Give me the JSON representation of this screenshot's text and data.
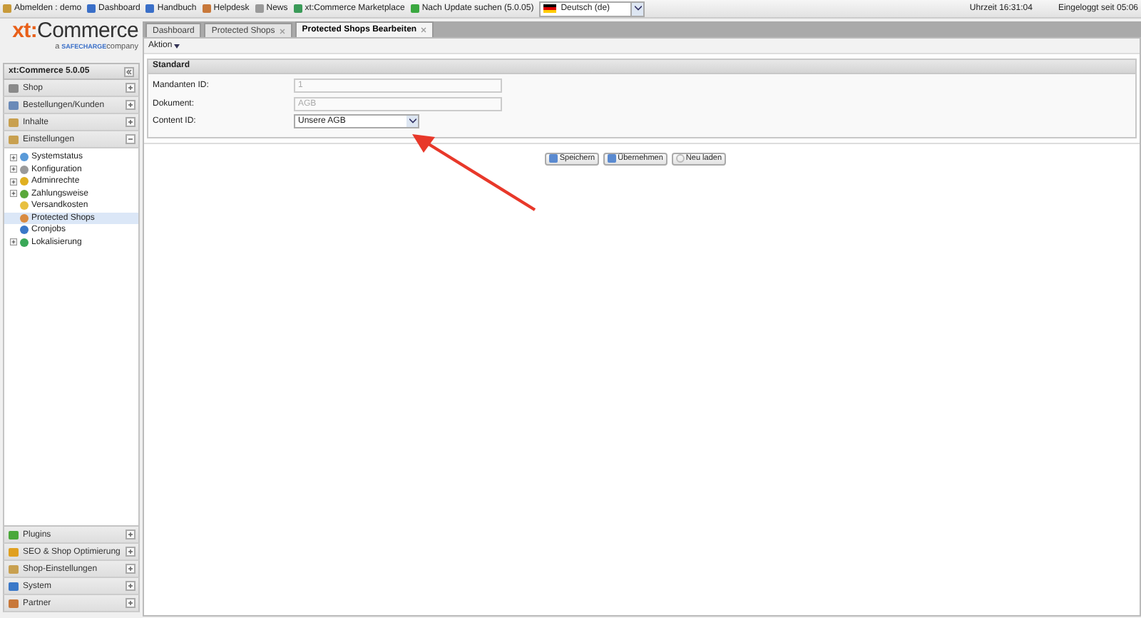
{
  "top_bar": {
    "items": [
      {
        "label": "Abmelden : demo",
        "kind": "logout"
      },
      {
        "label": "Dashboard",
        "kind": "chart"
      },
      {
        "label": "Handbuch",
        "kind": "book"
      },
      {
        "label": "Helpdesk",
        "kind": "person"
      },
      {
        "label": "News",
        "kind": "link"
      },
      {
        "label": "xt:Commerce Marketplace",
        "kind": "globe"
      },
      {
        "label": "Nach Update suchen (5.0.05)",
        "kind": "refresh"
      }
    ],
    "language": {
      "value": "Deutsch (de)"
    },
    "clock": "Uhrzeit 16:31:04",
    "session": "Eingeloggt seit 05:06"
  },
  "logo": {
    "brand_a": "xt:",
    "brand_b": "Commerce",
    "tagline_a": "a",
    "tagline_b": "SAFECHARGE",
    "tagline_c": "company"
  },
  "sidebar": {
    "title": "xt:Commerce 5.0.05",
    "panels": [
      {
        "label": "Shop",
        "expanded": false,
        "kind": "cart"
      },
      {
        "label": "Bestellungen/Kunden",
        "kind": "truck",
        "expanded": false
      },
      {
        "label": "Inhalte",
        "kind": "folder",
        "expanded": false
      },
      {
        "label": "Einstellungen",
        "kind": "folder",
        "expanded": true,
        "items": [
          {
            "label": "Systemstatus",
            "expanded": false,
            "selected": false,
            "color": "#5a9ad8"
          },
          {
            "label": "Konfiguration",
            "expanded": false,
            "selected": false,
            "color": "#9a9a9a"
          },
          {
            "label": "Adminrechte",
            "expanded": false,
            "selected": false,
            "color": "#e0b020"
          },
          {
            "label": "Zahlungsweise",
            "expanded": false,
            "selected": false,
            "color": "#5aa83a"
          },
          {
            "label": "Versandkosten",
            "selected": false,
            "color": "#e8c040"
          },
          {
            "label": "Protected Shops",
            "selected": true,
            "color": "#d88a40"
          },
          {
            "label": "Cronjobs",
            "selected": false,
            "color": "#3a78c8"
          },
          {
            "label": "Lokalisierung",
            "expanded": false,
            "selected": false,
            "color": "#3aa858"
          }
        ]
      }
    ],
    "bottom_panels": [
      {
        "label": "Plugins",
        "kind": "puzzle",
        "expanded": false
      },
      {
        "label": "SEO & Shop Optimierung",
        "kind": "bolt",
        "expanded": false
      },
      {
        "label": "Shop-Einstellungen",
        "kind": "folder",
        "expanded": false
      },
      {
        "label": "System",
        "kind": "monitor",
        "expanded": false
      },
      {
        "label": "Partner",
        "kind": "person",
        "expanded": false
      }
    ]
  },
  "tabs": [
    {
      "label": "Dashboard",
      "selected": false,
      "closable": false
    },
    {
      "label": "Protected Shops",
      "selected": false,
      "closable": true
    },
    {
      "label": "Protected Shops Bearbeiten",
      "selected": true,
      "closable": true
    }
  ],
  "toolbar": {
    "menu": "Aktion"
  },
  "form": {
    "title": "Standard",
    "fields": [
      {
        "label": "Mandanten ID:",
        "value": "1",
        "kind": "text",
        "disabled": true
      },
      {
        "label": "Dokument:",
        "value": "AGB",
        "kind": "text",
        "disabled": true
      },
      {
        "label": "Content ID:",
        "value": "Unsere AGB",
        "kind": "select",
        "disabled": false
      }
    ]
  },
  "buttons": [
    {
      "label": "Speichern",
      "kind": "save"
    },
    {
      "label": "Übernehmen",
      "kind": "apply"
    },
    {
      "label": "Neu laden",
      "kind": "reload"
    }
  ]
}
